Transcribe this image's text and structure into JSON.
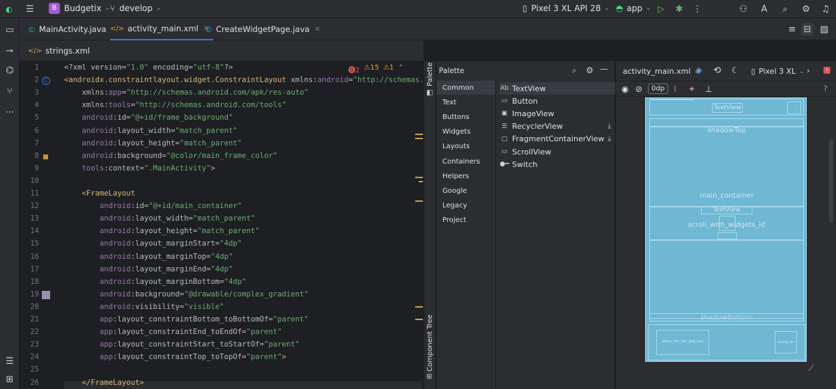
{
  "topbar": {
    "project_badge": "B",
    "project_name": "Budgetix",
    "branch": "develop",
    "device": "Pixel 3 XL API 28",
    "run_config": "app"
  },
  "editor_tabs": [
    {
      "label": "MainActivity.java",
      "active": false
    },
    {
      "label": "activity_main.xml",
      "active": true
    },
    {
      "label": "CreateWidgetPage.java",
      "active": false
    }
  ],
  "editor_tabs_row2": [
    {
      "label": "strings.xml"
    }
  ],
  "inspections": {
    "errors": "2",
    "warnings": "15",
    "weak": "1"
  },
  "code_lines": [
    {
      "n": "1",
      "html": "<span class='plain'>&lt;?xml version=</span><span class='str'>\"1.0\"</span><span class='plain'> encoding=</span><span class='str'>\"utf-8\"</span><span class='plain'>?&gt;</span>"
    },
    {
      "n": "2",
      "html": "<span class='tag'>&lt;androidx.constraintlayout.widget.ConstraintLayout</span> <span class='attr'>xmlns:</span><span class='ns'>android</span><span class='plain'>=</span><span class='str'>\"http://schemas.andr</span>"
    },
    {
      "n": "3",
      "html": "    <span class='attr'>xmlns:</span><span class='ns'>app</span><span class='plain'>=</span><span class='str'>\"http://schemas.android.com/apk/res-auto\"</span>"
    },
    {
      "n": "4",
      "html": "    <span class='attr'>xmlns:</span><span class='ns'>tools</span><span class='plain'>=</span><span class='str'>\"http://schemas.android.com/tools\"</span>"
    },
    {
      "n": "5",
      "html": "    <span class='ns'>android</span><span class='attr'>:id=</span><span class='str'>\"@+id/frame_background\"</span>"
    },
    {
      "n": "6",
      "html": "    <span class='ns'>android</span><span class='attr'>:layout_width=</span><span class='str'>\"match_parent\"</span>"
    },
    {
      "n": "7",
      "html": "    <span class='ns'>android</span><span class='attr'>:layout_height=</span><span class='str'>\"match_parent\"</span>"
    },
    {
      "n": "8",
      "html": "    <span class='ns'>android</span><span class='attr'>:background=</span><span class='str'>\"@color/main_frame_color\"</span>"
    },
    {
      "n": "9",
      "html": "    <span class='ns'>tools</span><span class='attr'>:context=</span><span class='str'>\".MainActivity\"</span><span class='tag'>&gt;</span>"
    },
    {
      "n": "10",
      "html": ""
    },
    {
      "n": "11",
      "html": "    <span class='tag'>&lt;FrameLayout</span>"
    },
    {
      "n": "12",
      "html": "        <span class='ns'>android</span><span class='attr'>:id=</span><span class='str'>\"@+id/main_container\"</span>"
    },
    {
      "n": "13",
      "html": "        <span class='ns'>android</span><span class='attr'>:layout_width=</span><span class='str'>\"match_parent\"</span>"
    },
    {
      "n": "14",
      "html": "        <span class='ns'>android</span><span class='attr'>:layout_height=</span><span class='str'>\"match_parent\"</span>"
    },
    {
      "n": "15",
      "html": "        <span class='ns'>android</span><span class='attr'>:layout_marginStart=</span><span class='str'>\"4dp\"</span>"
    },
    {
      "n": "16",
      "html": "        <span class='ns'>android</span><span class='attr'>:layout_marginTop=</span><span class='str'>\"4dp\"</span>"
    },
    {
      "n": "17",
      "html": "        <span class='ns'>android</span><span class='attr'>:layout_marginEnd=</span><span class='str'>\"4dp\"</span>"
    },
    {
      "n": "18",
      "html": "        <span class='ns'>android</span><span class='attr'>:layout_marginBottom=</span><span class='str'>\"4dp\"</span>"
    },
    {
      "n": "19",
      "html": "        <span class='ns'>android</span><span class='attr'>:background=</span><span class='str'>\"@drawable/complex_gradient\"</span>"
    },
    {
      "n": "20",
      "html": "        <span class='ns'>android</span><span class='attr'>:visibility=</span><span class='str'>\"visible\"</span>"
    },
    {
      "n": "21",
      "html": "        <span class='ns'>app</span><span class='attr'>:layout_constraintBottom_toBottomOf=</span><span class='str'>\"parent\"</span>"
    },
    {
      "n": "22",
      "html": "        <span class='ns'>app</span><span class='attr'>:layout_constraintEnd_toEndOf=</span><span class='str'>\"parent\"</span>"
    },
    {
      "n": "23",
      "html": "        <span class='ns'>app</span><span class='attr'>:layout_constraintStart_toStartOf=</span><span class='str'>\"parent\"</span>"
    },
    {
      "n": "24",
      "html": "        <span class='ns'>app</span><span class='attr'>:layout_constraintTop_toTopOf=</span><span class='str'>\"parent\"</span><span class='tag'>&gt;</span>"
    },
    {
      "n": "25",
      "html": ""
    },
    {
      "n": "26",
      "html": "    <span class='tag'>&lt;/FrameLayout&gt;</span>"
    }
  ],
  "side_strip": {
    "palette": "Palette",
    "component_tree": "Component Tree"
  },
  "palette": {
    "title": "Palette",
    "categories": [
      "Common",
      "Text",
      "Buttons",
      "Widgets",
      "Layouts",
      "Containers",
      "Helpers",
      "Google",
      "Legacy",
      "Project"
    ],
    "items": [
      {
        "icon": "Ab",
        "label": "TextView"
      },
      {
        "icon": "▭",
        "label": "Button"
      },
      {
        "icon": "▣",
        "label": "ImageView"
      },
      {
        "icon": "☰",
        "label": "RecyclerView",
        "download": true
      },
      {
        "icon": "▢",
        "label": "FragmentContainerView",
        "download": true
      },
      {
        "icon": "▭",
        "label": "ScrollView"
      },
      {
        "icon": "●━",
        "label": "Switch"
      }
    ]
  },
  "design": {
    "file": "activity_main.xml",
    "device": "Pixel 3 XL",
    "margin": "0dp",
    "labels": {
      "textview_top": "TextView",
      "shadow_top": "shadowTop",
      "main_container": "main_container",
      "textview_mid": "TextView",
      "scroll": "scroll_with_widgets_id",
      "shadow_bottom": "shadowBottom",
      "bottom_left": "about_hor_bar_app_text",
      "bottom_right": "settings_btn"
    }
  },
  "colors": {
    "accent": "#3574f0",
    "blueprint": "#6fb7d3"
  }
}
